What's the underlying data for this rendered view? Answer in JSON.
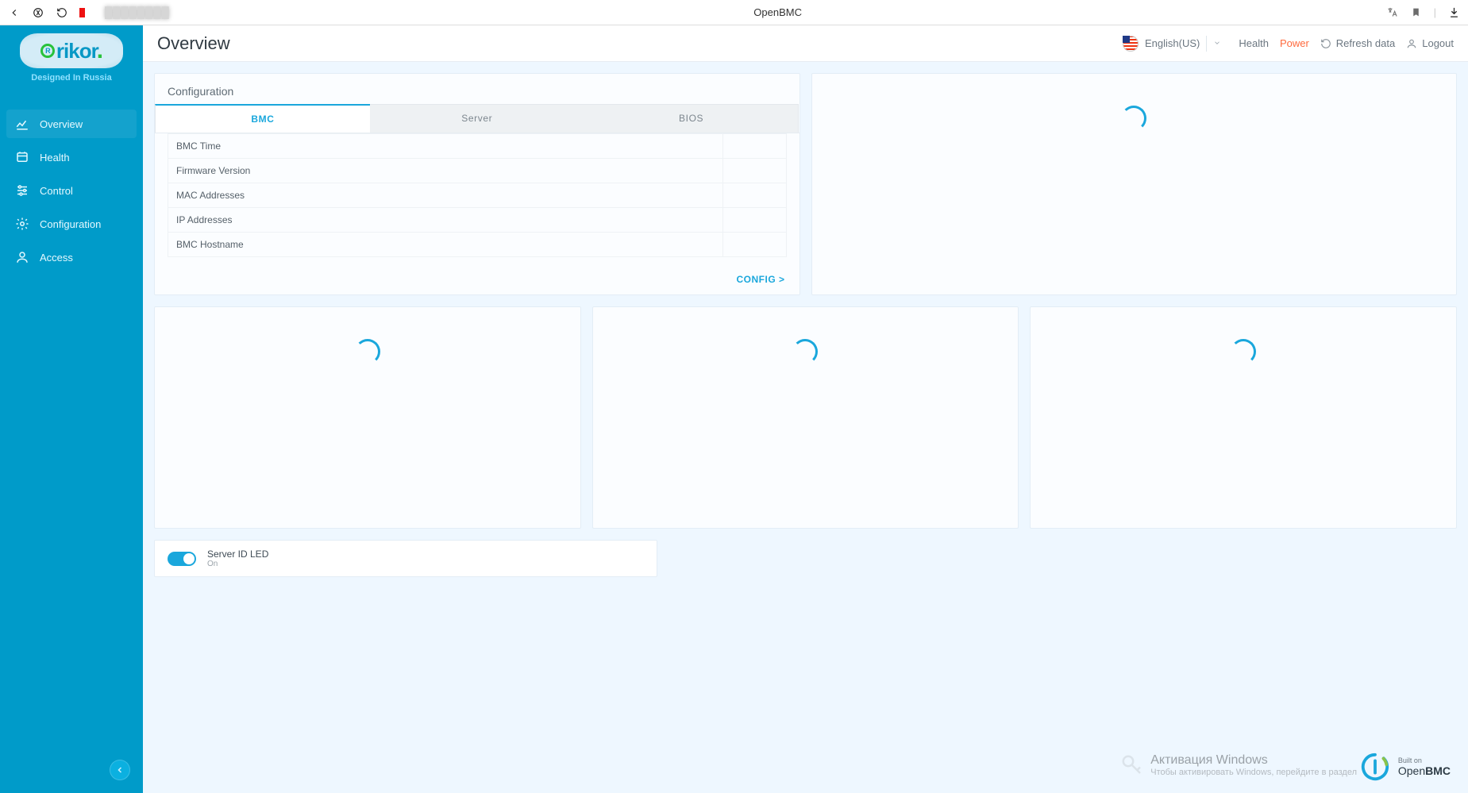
{
  "browser": {
    "title": "OpenBMC"
  },
  "brand": {
    "name": "rikor",
    "tag": "Designed In Russia"
  },
  "sidebar": {
    "items": [
      {
        "label": "Overview",
        "icon": "chart-icon",
        "active": true
      },
      {
        "label": "Health",
        "icon": "health-icon",
        "active": false
      },
      {
        "label": "Control",
        "icon": "sliders-icon",
        "active": false
      },
      {
        "label": "Configuration",
        "icon": "gear-icon",
        "active": false
      },
      {
        "label": "Access",
        "icon": "user-icon",
        "active": false
      }
    ]
  },
  "page": {
    "title": "Overview"
  },
  "topbar": {
    "lang_label": "English(US)",
    "health_label": "Health",
    "power_label": "Power",
    "refresh_label": "Refresh data",
    "logout_label": "Logout"
  },
  "config_card": {
    "title": "Configuration",
    "tabs": [
      {
        "label": "BMC",
        "active": true
      },
      {
        "label": "Server",
        "active": false
      },
      {
        "label": "BIOS",
        "active": false
      }
    ],
    "rows": [
      {
        "k": "BMC Time",
        "v": ""
      },
      {
        "k": "Firmware Version",
        "v": ""
      },
      {
        "k": "MAC Addresses",
        "v": ""
      },
      {
        "k": "IP Addresses",
        "v": ""
      },
      {
        "k": "BMC Hostname",
        "v": ""
      }
    ],
    "link": "CONFIG >"
  },
  "led": {
    "label": "Server ID LED",
    "state": "On"
  },
  "builton": {
    "small": "Built on",
    "name_a": "Open",
    "name_b": "BMC"
  },
  "watermark": {
    "line1": "Активация Windows",
    "line2": "Чтобы активировать Windows, перейдите в раздел"
  }
}
